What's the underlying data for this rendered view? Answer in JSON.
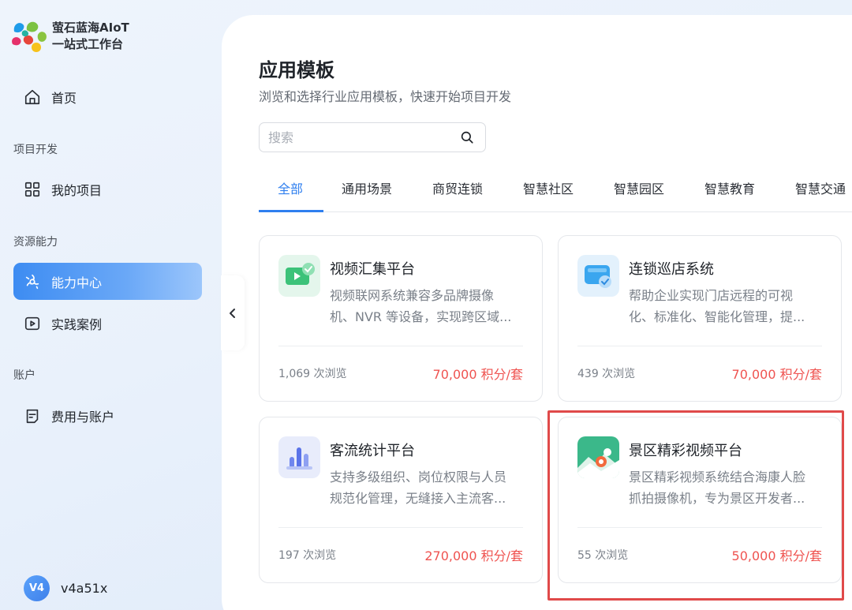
{
  "brand": {
    "line1": "萤石蓝海AIoT",
    "line2": "一站式工作台"
  },
  "nav": {
    "home": "首页",
    "section_project": "项目开发",
    "my_projects": "我的项目",
    "section_resource": "资源能力",
    "capability_center": "能力中心",
    "practice_cases": "实践案例",
    "section_account": "账户",
    "billing": "费用与账户"
  },
  "user": {
    "avatar_text": "V4",
    "name": "v4a51x"
  },
  "page": {
    "title": "应用模板",
    "subtitle": "浏览和选择行业应用模板，快速开始项目开发"
  },
  "search": {
    "placeholder": "搜索",
    "value": ""
  },
  "tabs": [
    {
      "label": "全部",
      "active": true
    },
    {
      "label": "通用场景",
      "active": false
    },
    {
      "label": "商贸连锁",
      "active": false
    },
    {
      "label": "智慧社区",
      "active": false
    },
    {
      "label": "智慧园区",
      "active": false
    },
    {
      "label": "智慧教育",
      "active": false
    },
    {
      "label": "智慧交通",
      "active": false
    }
  ],
  "cards": [
    {
      "name": "视频汇集平台",
      "desc_line1": "视频联网系统兼容多品牌摄像",
      "desc_line2": "机、NVR 等设备，实现跨区域...",
      "views": "1,069 次浏览",
      "price": "70,000 积分/套",
      "icon": "video-platform-icon"
    },
    {
      "name": "连锁巡店系统",
      "desc_line1": "帮助企业实现门店远程的可视",
      "desc_line2": "化、标准化、智能化管理，提...",
      "views": "439 次浏览",
      "price": "70,000 积分/套",
      "icon": "store-patrol-icon"
    },
    {
      "name": "客流统计平台",
      "desc_line1": "支持多级组织、岗位权限与人员",
      "desc_line2": "规范化管理，无缝接入主流客...",
      "views": "197 次浏览",
      "price": "270,000 积分/套",
      "icon": "traffic-stats-icon"
    },
    {
      "name": "景区精彩视频平台",
      "desc_line1": "景区精彩视频系统结合海康人脸",
      "desc_line2": "抓拍摄像机，专为景区开发者...",
      "views": "55 次浏览",
      "price": "50,000 积分/套",
      "icon": "scenic-landscape-icon"
    }
  ],
  "colors": {
    "accent": "#2f7fef",
    "price": "#ef5350",
    "highlight": "#e04a4a"
  }
}
